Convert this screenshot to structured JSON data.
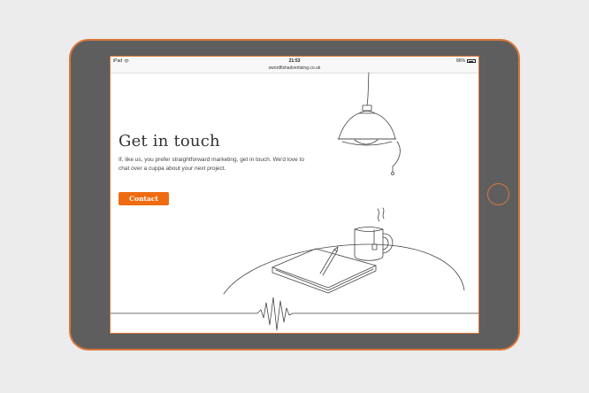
{
  "device": {
    "name": "iPad"
  },
  "status_bar": {
    "carrier": "iPad",
    "time": "21:53",
    "battery": "86%",
    "battery_level": 0.86
  },
  "browser": {
    "url": "swordfishadvertising.co.uk"
  },
  "page": {
    "headline": "Get in touch",
    "intro": "If, like us, you prefer straightforward marketing, get in touch. We'd love to chat over a cuppa about your next project.",
    "contact_label": "Contact"
  },
  "icons": {
    "wifi": "wifi-icon",
    "battery": "battery-icon",
    "home": "home-button"
  },
  "colors": {
    "accent": "#ef6b12",
    "frame_outline": "#d9773a",
    "device_body": "#5e5e5e",
    "background": "#ececec"
  }
}
